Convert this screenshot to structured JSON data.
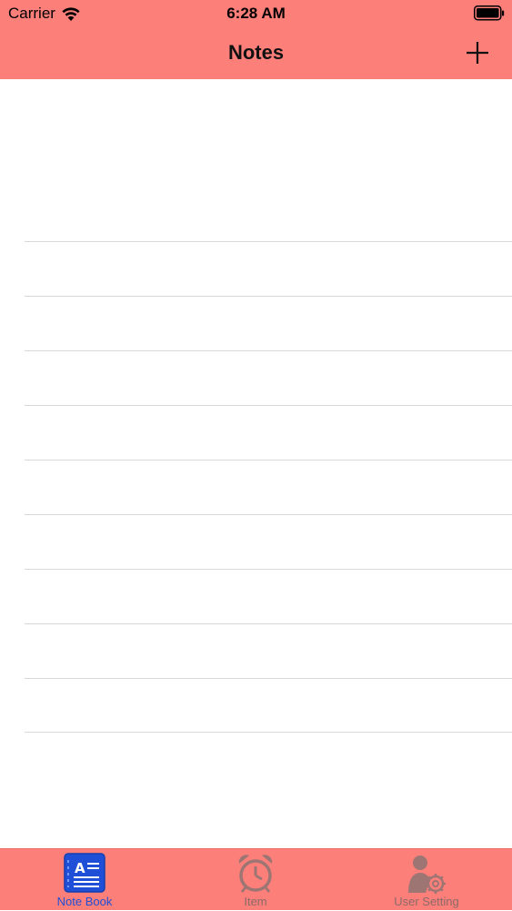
{
  "status_bar": {
    "carrier": "Carrier",
    "time": "6:28 AM",
    "wifi_icon": "wifi-icon",
    "battery_icon": "battery-icon"
  },
  "nav": {
    "title": "Notes",
    "add_icon": "plus-icon"
  },
  "tabs": [
    {
      "label": "Note Book",
      "icon": "notebook-icon",
      "active": true
    },
    {
      "label": "Item",
      "icon": "alarm-clock-icon",
      "active": false
    },
    {
      "label": "User Setting",
      "icon": "user-settings-icon",
      "active": false
    }
  ],
  "colors": {
    "header_bg": "#fd7f7a",
    "tab_active": "#1f4fd6",
    "tab_inactive": "#8a6a68",
    "rule_line": "#d9d9d9"
  }
}
